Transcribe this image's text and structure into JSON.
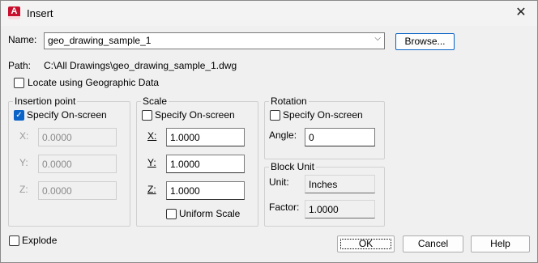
{
  "window": {
    "title": "Insert",
    "icon": "autocad-app-icon",
    "close": "✕"
  },
  "name_row": {
    "label": "Name:",
    "value": "geo_drawing_sample_1",
    "browse": "Browse..."
  },
  "path": {
    "label": "Path:",
    "value": "C:\\All Drawings\\geo_drawing_sample_1.dwg"
  },
  "geo": {
    "label": "Locate using Geographic Data",
    "checked": false
  },
  "insertion": {
    "title": "Insertion point",
    "specify": {
      "label": "Specify On-screen",
      "checked": true
    },
    "x_label": "X:",
    "x": "0.0000",
    "y_label": "Y:",
    "y": "0.0000",
    "z_label": "Z:",
    "z": "0.0000"
  },
  "scale": {
    "title": "Scale",
    "specify": {
      "label": "Specify On-screen",
      "checked": false
    },
    "x_label": "X:",
    "x": "1.0000",
    "y_label": "Y:",
    "y": "1.0000",
    "z_label": "Z:",
    "z": "1.0000",
    "uniform": {
      "label": "Uniform Scale",
      "checked": false
    }
  },
  "rotation": {
    "title": "Rotation",
    "specify": {
      "label": "Specify On-screen",
      "checked": false
    },
    "angle_label": "Angle:",
    "angle": "0"
  },
  "block_unit": {
    "title": "Block Unit",
    "unit_label": "Unit:",
    "unit": "Inches",
    "factor_label": "Factor:",
    "factor": "1.0000"
  },
  "explode": {
    "label": "Explode",
    "checked": false
  },
  "buttons": {
    "ok": "OK",
    "cancel": "Cancel",
    "help": "Help"
  },
  "colors": {
    "accent": "#0a64c8",
    "app_icon": "#c8102e"
  }
}
